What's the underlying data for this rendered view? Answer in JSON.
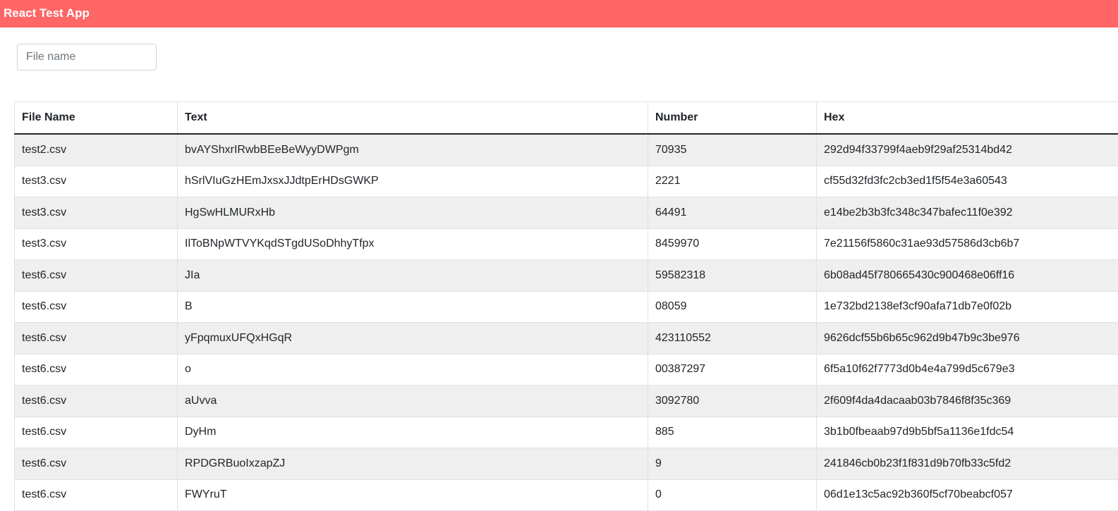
{
  "app": {
    "title": "React Test App",
    "accent_color": "#ff6666"
  },
  "search": {
    "placeholder": "File name",
    "value": ""
  },
  "table": {
    "headers": [
      "File Name",
      "Text",
      "Number",
      "Hex"
    ],
    "rows": [
      [
        "test2.csv",
        "bvAYShxrIRwbBEeBeWyyDWPgm",
        "70935",
        "292d94f33799f4aeb9f29af25314bd42"
      ],
      [
        "test3.csv",
        "hSrlVIuGzHEmJxsxJJdtpErHDsGWKP",
        "2221",
        "cf55d32fd3fc2cb3ed1f5f54e3a60543"
      ],
      [
        "test3.csv",
        "HgSwHLMURxHb",
        "64491",
        "e14be2b3b3fc348c347bafec11f0e392"
      ],
      [
        "test3.csv",
        "IlToBNpWTVYKqdSTgdUSoDhhyTfpx",
        "8459970",
        "7e21156f5860c31ae93d57586d3cb6b7"
      ],
      [
        "test6.csv",
        "JIa",
        "59582318",
        "6b08ad45f780665430c900468e06ff16"
      ],
      [
        "test6.csv",
        "B",
        "08059",
        "1e732bd2138ef3cf90afa71db7e0f02b"
      ],
      [
        "test6.csv",
        "yFpqmuxUFQxHGqR",
        "423110552",
        "9626dcf55b6b65c962d9b47b9c3be976"
      ],
      [
        "test6.csv",
        "o",
        "00387297",
        "6f5a10f62f7773d0b4e4a799d5c679e3"
      ],
      [
        "test6.csv",
        "aUvva",
        "3092780",
        "2f609f4da4dacaab03b7846f8f35c369"
      ],
      [
        "test6.csv",
        "DyHm",
        "885",
        "3b1b0fbeaab97d9b5bf5a1136e1fdc54"
      ],
      [
        "test6.csv",
        "RPDGRBuoIxzapZJ",
        "9",
        "241846cb0b23f1f831d9b70fb33c5fd2"
      ],
      [
        "test6.csv",
        "FWYruT",
        "0",
        "06d1e13c5ac92b360f5cf70beabcf057"
      ]
    ]
  }
}
